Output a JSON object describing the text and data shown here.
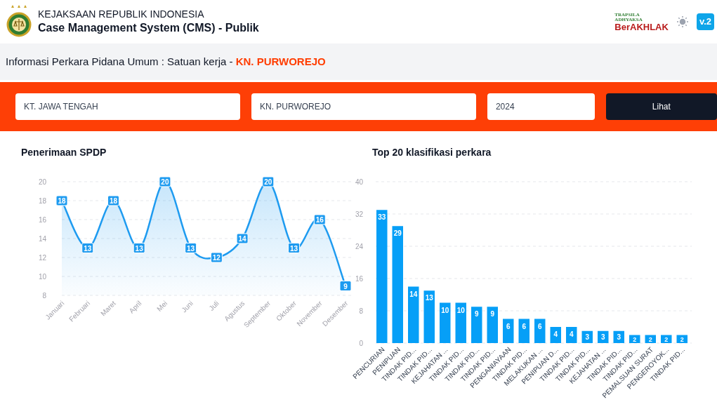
{
  "header": {
    "org": "KEJAKSAAN REPUBLIK INDONESIA",
    "app": "Case Management System (CMS) - Publik",
    "badge_logo": {
      "top": "TRAPSILA",
      "middle": "ADHYAKSA",
      "main": "BerAKHLAK"
    },
    "version": "v.2"
  },
  "page_title": {
    "text": "Informasi Perkara Pidana Umum : Satuan kerja - ",
    "unit": "KN. PURWOREJO"
  },
  "filters": {
    "province": "KT. JAWA TENGAH",
    "unit": "KN. PURWOREJO",
    "year": "2024",
    "button": "Lihat"
  },
  "spdp": {
    "title": "Penerimaan SPDP",
    "chart_data": {
      "type": "area",
      "categories": [
        "Januari",
        "Februari",
        "Maret",
        "April",
        "Mei",
        "Juni",
        "Juli",
        "Agustus",
        "September",
        "Oktober",
        "November",
        "Desember"
      ],
      "grid": true,
      "series": [
        {
          "color": "#1e9bf0",
          "values": [
            18,
            13,
            18,
            13,
            20,
            13,
            12,
            14,
            20,
            13,
            16,
            9
          ]
        }
      ],
      "ylim": [
        8,
        20
      ],
      "yticks": [
        8,
        10,
        12,
        14,
        16,
        18,
        20
      ],
      "data_labels": true
    }
  },
  "top20": {
    "title": "Top 20 klasifikasi perkara",
    "chart_data": {
      "type": "bar",
      "categories": [
        "PENCURIAN",
        "PENIPUAN",
        "TINDAK PID...",
        "TINDAK PID...",
        "KEJAHATAN ...",
        "TINDAK PID...",
        "TINDAK PID...",
        "TINDAK PID...",
        "PENGANIAYAAN",
        "TINDAK PID...",
        "MELAKUKAN ...",
        "PENIPUAN D...",
        "TINDAK PID...",
        "TINDAK PID...",
        "KEJAHATAN ...",
        "TINDAK PID...",
        "TINDAK PID...",
        "PEMALSUAN SURAT",
        "PENGEROYOK...",
        "TINDAK PID..."
      ],
      "grid": true,
      "series": [
        {
          "color": "#069ff7",
          "values": [
            33,
            29,
            14,
            13,
            10,
            10,
            9,
            9,
            6,
            6,
            6,
            4,
            4,
            3,
            3,
            3,
            2,
            2,
            2,
            2
          ]
        }
      ],
      "ylim": [
        0,
        40
      ],
      "yticks": [
        0,
        8,
        16,
        24,
        32,
        40
      ],
      "data_labels": true
    }
  }
}
